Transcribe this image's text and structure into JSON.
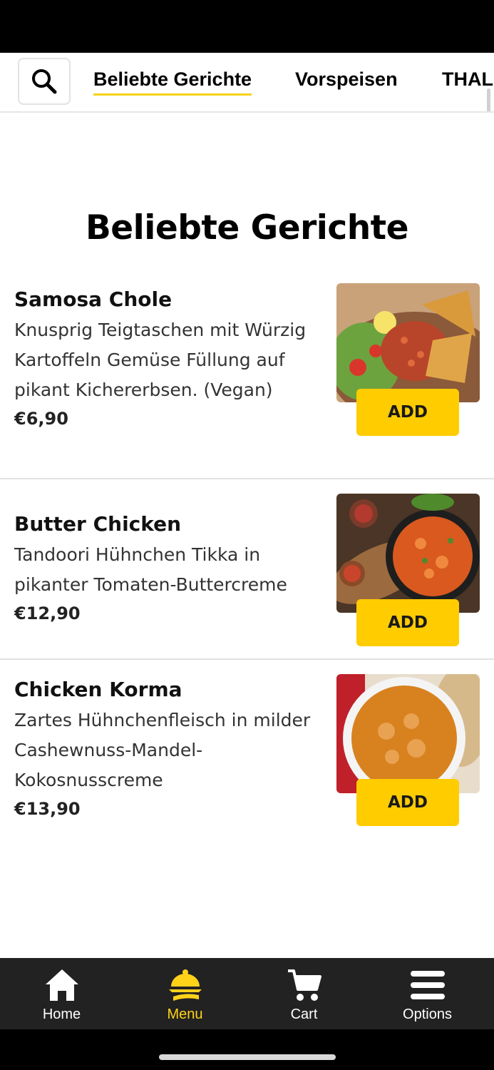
{
  "tabs": [
    {
      "label": "Beliebte Gerichte",
      "active": true
    },
    {
      "label": "Vorspeisen",
      "active": false
    },
    {
      "label": "THAL",
      "active": false
    }
  ],
  "search": {
    "icon": "search-icon"
  },
  "section": {
    "title": "Beliebte Gerichte"
  },
  "items": [
    {
      "name": "Samosa Chole",
      "description": "Knusprig Teigtaschen mit Würzig Kartoffeln Gemüse Füllung auf pikant Kichererbsen. (Vegan)",
      "price": "€6,90",
      "add_label": "ADD"
    },
    {
      "name": "Butter Chicken",
      "description": "Tandoori Hühnchen Tikka in pikanter Tomaten-Buttercreme",
      "price": "€12,90",
      "add_label": "ADD"
    },
    {
      "name": "Chicken Korma",
      "description": "Zartes Hühnchenfleisch in milder Cashewnuss-Mandel-Kokosnusscreme",
      "price": "€13,90",
      "add_label": "ADD"
    }
  ],
  "nav": [
    {
      "label": "Home",
      "icon": "home-icon",
      "active": false
    },
    {
      "label": "Menu",
      "icon": "menu-cloche-icon",
      "active": true
    },
    {
      "label": "Cart",
      "icon": "cart-icon",
      "active": false
    },
    {
      "label": "Options",
      "icon": "hamburger-icon",
      "active": false
    }
  ],
  "colors": {
    "accent": "#ffcc00",
    "nav_background": "#222222",
    "active_nav": "#ffd21a"
  }
}
